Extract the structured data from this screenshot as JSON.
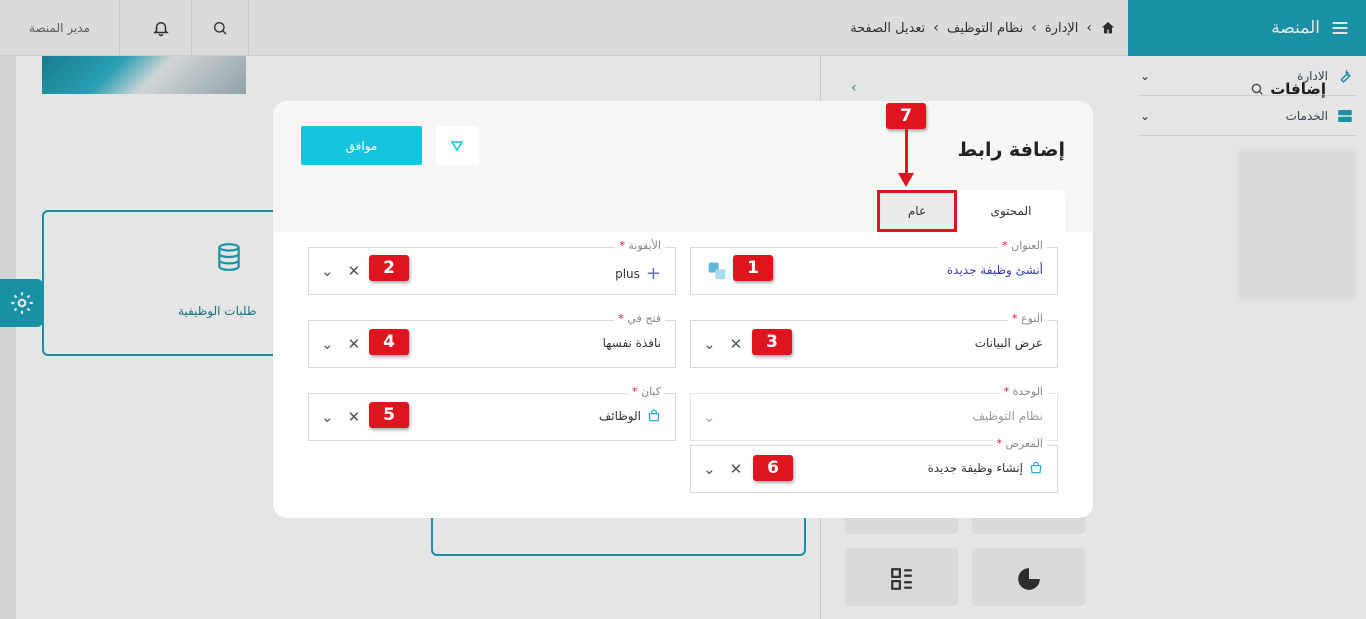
{
  "topbar": {
    "user_label": "مدير المنصة",
    "breadcrumb": [
      "الإدارة",
      "نظام التوظيف",
      "تعديل الصفحة"
    ]
  },
  "sidebar": {
    "title": "المنصة",
    "items": [
      {
        "label": "الادارة",
        "icon": "wrench-icon"
      },
      {
        "label": "الخدمات",
        "icon": "server-icon"
      }
    ]
  },
  "background": {
    "panel_title": "إضافات",
    "card_label": "طلبات الوظيفية"
  },
  "modal": {
    "title": "إضافة رابط",
    "ok_label": "موافق",
    "tabs": [
      {
        "label": "المحتوى",
        "active": true
      },
      {
        "label": "عام",
        "active": false
      }
    ],
    "fields": {
      "title": {
        "label": "العنوان",
        "value": "أنشئ وظيفة جديدة"
      },
      "icon": {
        "label": "الأيقونة",
        "value": "plus"
      },
      "type": {
        "label": "النوع",
        "value": "عرض البيانات"
      },
      "open_in": {
        "label": "فتح في",
        "value": "نافذة نفسها"
      },
      "unit": {
        "label": "الوحدة",
        "value": "نظام التوظيف"
      },
      "entity": {
        "label": "كيان",
        "value": "الوظائف"
      },
      "view": {
        "label": "المعرض",
        "value": "إنشاء وظيفة جديدة"
      }
    },
    "required_mark": "*"
  },
  "annotations": {
    "b1": "1",
    "b2": "2",
    "b3": "3",
    "b4": "4",
    "b5": "5",
    "b6": "6",
    "b7": "7"
  },
  "colors": {
    "accent": "#1aa2b6",
    "ok_button": "#17c4e0",
    "annotation_red": "#e0141e"
  }
}
